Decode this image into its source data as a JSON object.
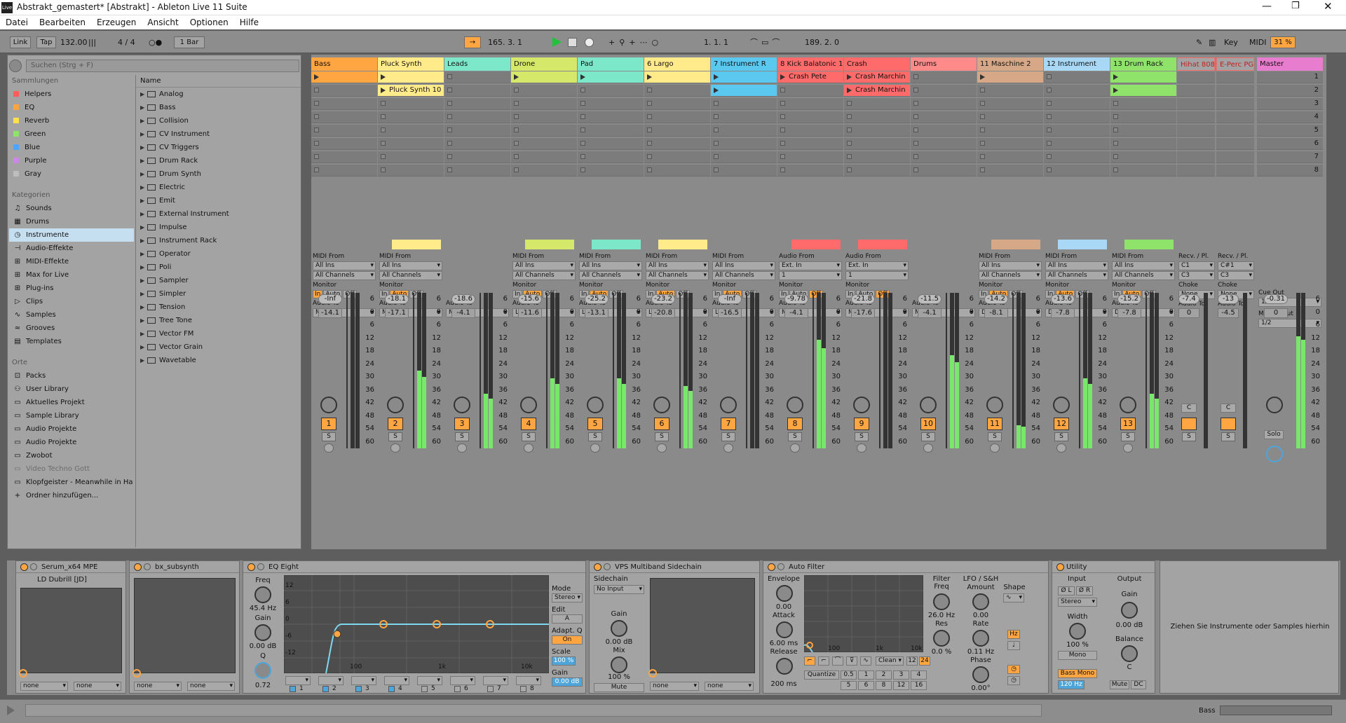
{
  "window": {
    "title": "Abstrakt_gemastert*  [Abstrakt] - Ableton Live 11 Suite",
    "app_badge": "Live"
  },
  "menu": [
    "Datei",
    "Bearbeiten",
    "Erzeugen",
    "Ansicht",
    "Optionen",
    "Hilfe"
  ],
  "transport": {
    "link": "Link",
    "tap": "Tap",
    "tempo": "132.00",
    "signature": "4 / 4",
    "quantize": "1 Bar",
    "position": "165.  3.  1",
    "loop_start": "1.  1.  1",
    "loop_length": "189.  2.  0",
    "key": "Key",
    "midi": "MIDI",
    "cpu": "31 %"
  },
  "browser": {
    "search_placeholder": "Suchen (Strg + F)",
    "collections_label": "Sammlungen",
    "collections": [
      {
        "label": "Helpers",
        "color": "#ff5c5c"
      },
      {
        "label": "EQ",
        "color": "#ffa642"
      },
      {
        "label": "Reverb",
        "color": "#ffe14a"
      },
      {
        "label": "Green",
        "color": "#8fe36b"
      },
      {
        "label": "Blue",
        "color": "#4ea5ff"
      },
      {
        "label": "Purple",
        "color": "#c88ae6"
      },
      {
        "label": "Gray",
        "color": "#bdbdbd"
      }
    ],
    "categories_label": "Kategorien",
    "categories": [
      {
        "label": "Sounds",
        "icon": "♫"
      },
      {
        "label": "Drums",
        "icon": "▦"
      },
      {
        "label": "Instrumente",
        "icon": "◷",
        "selected": true
      },
      {
        "label": "Audio-Effekte",
        "icon": "⊣"
      },
      {
        "label": "MIDI-Effekte",
        "icon": "⊞"
      },
      {
        "label": "Max for Live",
        "icon": "⊞"
      },
      {
        "label": "Plug-ins",
        "icon": "⊞"
      },
      {
        "label": "Clips",
        "icon": "▷"
      },
      {
        "label": "Samples",
        "icon": "∿"
      },
      {
        "label": "Grooves",
        "icon": "≈"
      },
      {
        "label": "Templates",
        "icon": "▤"
      }
    ],
    "places_label": "Orte",
    "places": [
      {
        "label": "Packs",
        "icon": "⊡"
      },
      {
        "label": "User Library",
        "icon": "⚇"
      },
      {
        "label": "Aktuelles Projekt",
        "icon": "▭"
      },
      {
        "label": "Sample Library",
        "icon": "▭"
      },
      {
        "label": "Audio Projekte",
        "icon": "▭"
      },
      {
        "label": "Audio Projekte",
        "icon": "▭"
      },
      {
        "label": "Zwobot",
        "icon": "▭"
      },
      {
        "label": "Video Techno Gott",
        "icon": "▭",
        "dim": true
      },
      {
        "label": "Klopfgeister - Meanwhile in Ha",
        "icon": "▭"
      },
      {
        "label": "Ordner hinzufügen...",
        "icon": "+"
      }
    ],
    "name_header": "Name",
    "items": [
      "Analog",
      "Bass",
      "Collision",
      "CV Instrument",
      "CV Triggers",
      "Drum Rack",
      "Drum Synth",
      "Electric",
      "Emit",
      "External Instrument",
      "Impulse",
      "Instrument Rack",
      "Operator",
      "Poli",
      "Sampler",
      "Simpler",
      "Tension",
      "Tree Tone",
      "Vector FM",
      "Vector Grain",
      "Wavetable"
    ]
  },
  "tracks": [
    {
      "name": "Bass",
      "color": "#ffa642",
      "num": "1",
      "vol": "-Inf",
      "peak": "-14.1",
      "io_type": "MIDI From",
      "in1": "All Ins",
      "in2": "All Channels",
      "mon": "In",
      "out": "Master",
      "clips": [
        {
          "slot": 0,
          "label": "",
          "color": "#ffa642"
        }
      ],
      "meter": 0,
      "bar": ""
    },
    {
      "name": "Pluck Synth",
      "color": "#ffeb8a",
      "num": "2",
      "vol": "-18.1",
      "peak": "-17.1",
      "io_type": "MIDI From",
      "in1": "All Ins",
      "in2": "All Channels",
      "mon": "Auto",
      "out": "Master",
      "clips": [
        {
          "slot": 0,
          "label": "",
          "color": "#ffeb8a"
        },
        {
          "slot": 1,
          "label": "Pluck Synth 10",
          "color": "#ffeb8a"
        }
      ],
      "meter": 0.5,
      "bar": "#ffeb8a"
    },
    {
      "name": "Leads",
      "color": "#7de8c9",
      "num": "3",
      "vol": "-18.6",
      "peak": "-4.1",
      "io_type": "",
      "in1": "",
      "in2": "",
      "mon": "",
      "out": "Master",
      "clips": [],
      "meter": 0.35,
      "bar": ""
    },
    {
      "name": "Drone",
      "color": "#d5e86a",
      "num": "4",
      "vol": "-15.6",
      "peak": "-11.6",
      "io_type": "MIDI From",
      "in1": "All Ins",
      "in2": "All Channels",
      "mon": "Auto",
      "out": "Leads",
      "clips": [
        {
          "slot": 0,
          "label": "",
          "color": "#d5e86a"
        }
      ],
      "meter": 0.45,
      "bar": "#d5e86a"
    },
    {
      "name": "Pad",
      "color": "#7de8c9",
      "num": "5",
      "vol": "-25.2",
      "peak": "-13.1",
      "io_type": "MIDI From",
      "in1": "All Ins",
      "in2": "All Channels",
      "mon": "Auto",
      "out": "Leads",
      "clips": [
        {
          "slot": 0,
          "label": "",
          "color": "#7de8c9"
        }
      ],
      "meter": 0.45,
      "bar": "#7de8c9"
    },
    {
      "name": "6 Largo",
      "color": "#ffeb8a",
      "num": "6",
      "vol": "-23.2",
      "peak": "-20.8",
      "io_type": "MIDI From",
      "in1": "All Ins",
      "in2": "All Channels",
      "mon": "Auto",
      "out": "Leads",
      "clips": [
        {
          "slot": 0,
          "label": "",
          "color": "#ffeb8a"
        }
      ],
      "meter": 0.4,
      "bar": "#ffeb8a"
    },
    {
      "name": "7 Instrument R",
      "color": "#5bc8f0",
      "num": "7",
      "vol": "-Inf",
      "peak": "-16.5",
      "io_type": "MIDI From",
      "in1": "All Ins",
      "in2": "All Channels",
      "mon": "Auto",
      "out": "Leads",
      "clips": [
        {
          "slot": 0,
          "label": "",
          "color": "#5bc8f0"
        },
        {
          "slot": 1,
          "label": "",
          "color": "#5bc8f0"
        }
      ],
      "meter": 0,
      "bar": ""
    },
    {
      "name": "8 Kick Balatonic 1",
      "color": "#ff6b6b",
      "num": "8",
      "vol": "-9.78",
      "peak": "-4.1",
      "io_type": "Audio From",
      "in1": "Ext. In",
      "in2": "1",
      "mon": "Off",
      "out": "Master",
      "clips": [
        {
          "slot": 0,
          "label": "Crash Pete",
          "color": "#ff6b6b"
        }
      ],
      "meter": 0.7,
      "bar": "#ff6b6b"
    },
    {
      "name": "Crash",
      "color": "#ff6b6b",
      "num": "9",
      "vol": "-21.8",
      "peak": "-17.6",
      "io_type": "Audio From",
      "in1": "Ext. In",
      "in2": "1",
      "mon": "Off",
      "out": "Master",
      "clips": [
        {
          "slot": 0,
          "label": "Crash Marchin",
          "color": "#ff6b6b"
        },
        {
          "slot": 1,
          "label": "Crash Marchin",
          "color": "#ff6b6b"
        }
      ],
      "meter": 0,
      "bar": "#ff6b6b"
    },
    {
      "name": "Drums",
      "color": "#ff8a8a",
      "num": "10",
      "vol": "-11.5",
      "peak": "-4.1",
      "io_type": "",
      "in1": "",
      "in2": "",
      "mon": "",
      "out": "Master",
      "clips": [],
      "meter": 0.6,
      "bar": ""
    },
    {
      "name": "11 Maschine 2",
      "color": "#d6a888",
      "num": "11",
      "vol": "-14.2",
      "peak": "-8.1",
      "io_type": "MIDI From",
      "in1": "All Ins",
      "in2": "All Channels",
      "mon": "Auto",
      "out": "Drums",
      "clips": [
        {
          "slot": 0,
          "label": "",
          "color": "#d6a888"
        }
      ],
      "meter": 0.15,
      "bar": "#d6a888"
    },
    {
      "name": "12 Instrument",
      "color": "#a8d8f5",
      "num": "12",
      "vol": "-13.6",
      "peak": "-7.8",
      "io_type": "MIDI From",
      "in1": "All Ins",
      "in2": "All Channels",
      "mon": "Auto",
      "out": "Drums",
      "clips": [],
      "meter": 0.45,
      "bar": "#a8d8f5"
    },
    {
      "name": "13 Drum Rack",
      "color": "#8fe36b",
      "num": "13",
      "vol": "-15.2",
      "peak": "-7.8",
      "io_type": "MIDI From",
      "in1": "All Ins",
      "in2": "All Channels",
      "mon": "Auto",
      "out": "Drums",
      "clips": [
        {
          "slot": 0,
          "label": "",
          "color": "#8fe36b"
        },
        {
          "slot": 1,
          "label": "",
          "color": "#8fe36b"
        }
      ],
      "meter": 0.35,
      "bar": "#8fe36b"
    }
  ],
  "chains": [
    {
      "name": "Hihat 808",
      "recv": "Recv. / Pl.",
      "note": "C1",
      "note2": "C3",
      "choke": "Choke",
      "choke_val": "None",
      "audio_to": "Audio To",
      "vol": "-7.4",
      "pan": "0",
      "pan_label": "C"
    },
    {
      "name": "E-Perc PG",
      "recv": "Recv. / Pl.",
      "note": "C#1",
      "note2": "C3",
      "choke": "Choke",
      "choke_val": "None",
      "audio_to": "Audio To",
      "vol": "-13",
      "pan": "-4.5",
      "pan_label": "C"
    }
  ],
  "master": {
    "name": "Master",
    "vol": "-0.31",
    "pan": "0",
    "cue_label": "Cue Out",
    "cue_val": "1/2",
    "out_label": "Master Out",
    "out_val": "1/2",
    "solo": "Solo",
    "slots": [
      "1",
      "2",
      "3",
      "4",
      "5",
      "6",
      "7",
      "8"
    ]
  },
  "io_labels": {
    "monitor": "Monitor",
    "audio_to": "Audio To",
    "mon_in": "In",
    "mon_auto": "Auto",
    "mon_off": "Off",
    "solo": "S"
  },
  "scale": [
    "6",
    "0",
    "6",
    "12",
    "18",
    "24",
    "30",
    "36",
    "42",
    "48",
    "54",
    "60"
  ],
  "devices": {
    "serum": {
      "name": "Serum_x64 MPE",
      "preset": "LD Dubrill [JD]",
      "sel1": "none",
      "sel2": "none"
    },
    "bx": {
      "name": "bx_subsynth",
      "sel1": "none",
      "sel2": "none"
    },
    "eq": {
      "name": "EQ Eight",
      "freq_label": "Freq",
      "freq": "45.4 Hz",
      "gain_label": "Gain",
      "gain": "0.00 dB",
      "q_label": "Q",
      "q": "0.72",
      "mode_label": "Mode",
      "mode": "Stereo",
      "edit_label": "Edit",
      "edit": "A",
      "adapt_label": "Adapt. Q",
      "adapt": "On",
      "scale_label": "Scale",
      "scale": "100 %",
      "gain2_label": "Gain",
      "gain2": "0.00 dB",
      "ylabels": [
        "12",
        "6",
        "0",
        "-6",
        "-12"
      ],
      "xlabels": [
        "100",
        "1k",
        "10k"
      ],
      "bands": [
        "1",
        "2",
        "3",
        "4",
        "5",
        "6",
        "7",
        "8"
      ]
    },
    "vps": {
      "name": "VPS Multiband Sidechain",
      "side_label": "Sidechain",
      "side": "No Input",
      "gain_label": "Gain",
      "gain": "0.00 dB",
      "mix_label": "Mix",
      "mix": "100 %",
      "mute": "Mute",
      "sel1": "none",
      "sel2": "none"
    },
    "af": {
      "name": "Auto Filter",
      "env_label": "Envelope",
      "env": "0.00",
      "attack_label": "Attack",
      "attack": "6.00 ms",
      "release_label": "Release",
      "release": "200 ms",
      "freq_label": "Filter Freq",
      "freq": "26.0 Hz",
      "res_label": "Res",
      "res": "0.0 %",
      "lfo_label": "LFO / S&H",
      "amount_label": "Amount",
      "amount": "0.00",
      "rate_label": "Rate",
      "rate": "0.11 Hz",
      "phase_label": "Phase",
      "phase": "0.00°",
      "shape_label": "Shape",
      "hz": "Hz",
      "clean": "Clean",
      "q12": "12",
      "q24": "24",
      "quantize": "Quantize",
      "qvals": [
        "0.5",
        "1",
        "2",
        "3",
        "4",
        "5",
        "6",
        "8",
        "12",
        "16"
      ],
      "xlabels": [
        "100",
        "1k",
        "10k"
      ]
    },
    "util": {
      "name": "Utility",
      "input_label": "Input",
      "output_label": "Output",
      "phase_l": "Ø L",
      "phase_r": "Ø R",
      "mode": "Stereo",
      "width_label": "Width",
      "width": "100 %",
      "mono": "Mono",
      "bassmono": "Bass Mono",
      "bassfreq": "120 Hz",
      "gain_label": "Gain",
      "gain": "0.00 dB",
      "balance_label": "Balance",
      "balance": "C",
      "mute": "Mute",
      "dc": "DC"
    },
    "drop_hint": "Ziehen Sie Instrumente oder Samples hierhin"
  },
  "status": {
    "track": "Bass"
  }
}
